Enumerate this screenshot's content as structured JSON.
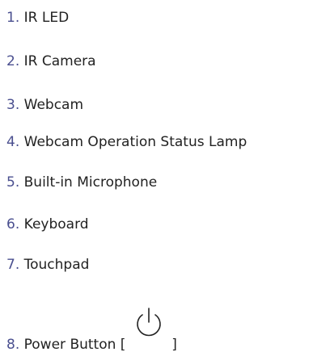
{
  "list": {
    "items": [
      {
        "number": "1.",
        "label": "IR LED"
      },
      {
        "number": "2.",
        "label": "IR Camera"
      },
      {
        "number": "3.",
        "label": "Webcam"
      },
      {
        "number": "4.",
        "label": "Webcam Operation Status Lamp"
      },
      {
        "number": "5.",
        "label": "Built-in Microphone"
      },
      {
        "number": "6.",
        "label": "Keyboard"
      },
      {
        "number": "7.",
        "label": "Touchpad"
      },
      {
        "number": "8.",
        "label": "Power Button [",
        "suffix": "]",
        "icon": "power-icon"
      }
    ]
  },
  "colors": {
    "number": "#4a4f8f",
    "text": "#222222"
  }
}
